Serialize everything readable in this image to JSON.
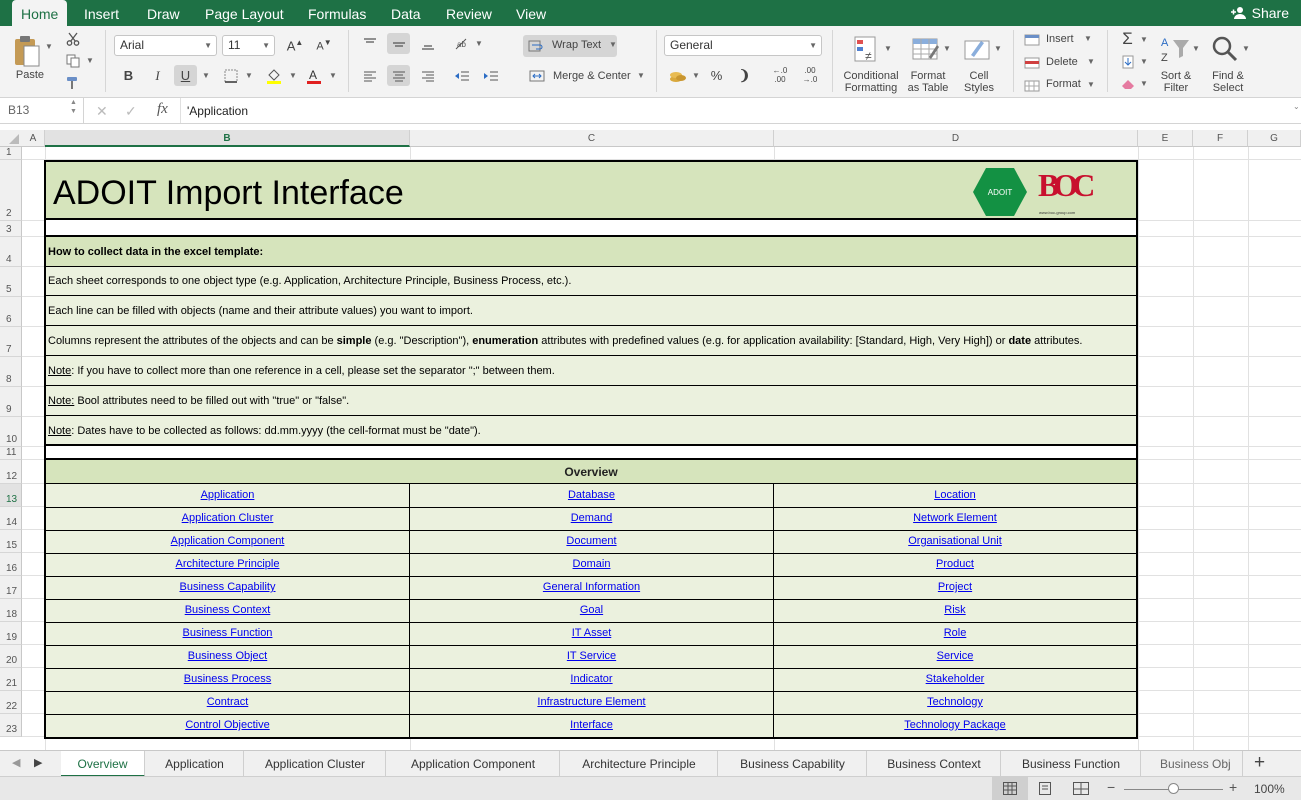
{
  "ribbon_tabs": [
    "Home",
    "Insert",
    "Draw",
    "Page Layout",
    "Formulas",
    "Data",
    "Review",
    "View"
  ],
  "share_label": "Share",
  "clipboard": {
    "paste_label": "Paste"
  },
  "font": {
    "name": "Arial",
    "size": "11"
  },
  "alignment": {
    "wrap_text": "Wrap Text",
    "merge_center": "Merge & Center"
  },
  "number": {
    "format": "General",
    "percent": "%",
    "inc_decimal_top": "←.0",
    "inc_decimal_bottom": ".00",
    "dec_decimal_top": ".00",
    "dec_decimal_bottom": "→.0"
  },
  "styles": {
    "conditional": "Conditional\nFormatting",
    "format_table": "Format\nas Table",
    "cell_styles": "Cell\nStyles"
  },
  "cells_group": {
    "insert": "Insert",
    "delete": "Delete",
    "format": "Format"
  },
  "editing": {
    "sort_filter": "Sort &\nFilter",
    "find_select": "Find &\nSelect"
  },
  "formula_bar": {
    "name_box": "B13",
    "fx": "fx",
    "content": "'Application"
  },
  "columns": [
    "A",
    "B",
    "C",
    "D",
    "E",
    "F",
    "G"
  ],
  "rows": [
    "1",
    "2",
    "3",
    "4",
    "5",
    "6",
    "7",
    "8",
    "9",
    "10",
    "11",
    "12",
    "13",
    "14",
    "15",
    "16",
    "17",
    "18",
    "19",
    "20",
    "21",
    "22",
    "23"
  ],
  "sheet": {
    "title": "ADOIT Import Interface",
    "logo_adoit": "ADOIT",
    "logo_boc": "BOC",
    "logo_boc_small": "www.boc-group.com",
    "heading": "How to collect data in the excel template:",
    "line1": "Each sheet corresponds to one object type (e.g. Application, Architecture Principle, Business Process, etc.).",
    "line2": "Each line can be filled with objects (name and their attribute values) you want to import.",
    "line3_a": "Columns represent the attributes of the objects and can be ",
    "line3_b": "simple",
    "line3_c": " (e.g. \"Description\"), ",
    "line3_d": "enumeration",
    "line3_e": " attributes with predefined values (e.g. for application availability: [Standard, High, Very High]) or ",
    "line3_f": "date",
    "line3_g": " attributes.",
    "note_label": "Note",
    "note_label_colon": "Note:",
    "note1": ": If you have to collect more than one reference in a cell, please set the separator \";\" between them.",
    "note2": " Bool attributes need to be filled out with \"true\" or \"false\".",
    "note3": ": Dates have to be collected as follows: dd.mm.yyyy (the cell-format must be \"date\").",
    "overview": "Overview",
    "links_b": [
      "Application",
      "Application Cluster",
      "Application Component",
      "Architecture Principle",
      "Business Capability",
      "Business Context",
      "Business Function",
      "Business Object",
      "Business Process",
      "Contract",
      "Control Objective"
    ],
    "links_c": [
      "Database",
      "Demand",
      "Document",
      "Domain",
      "General Information",
      "Goal",
      "IT Asset",
      "IT Service",
      "Indicator",
      "Infrastructure Element",
      "Interface"
    ],
    "links_d": [
      "Location",
      "Network Element",
      "Organisational Unit",
      "Product",
      "Project",
      "Risk",
      "Role",
      "Service",
      "Stakeholder",
      "Technology",
      "Technology Package"
    ]
  },
  "sheet_tabs": [
    "Overview",
    "Application",
    "Application Cluster",
    "Application Component",
    "Architecture Principle",
    "Business Capability",
    "Business Context",
    "Business Function",
    "Business Obj"
  ],
  "add_sheet": "+",
  "zoom": "100%",
  "colors": {
    "excel_green": "#1e7145",
    "header_fill": "#d6e4bc",
    "body_fill": "#ebf1de",
    "link": "#0000ee"
  }
}
